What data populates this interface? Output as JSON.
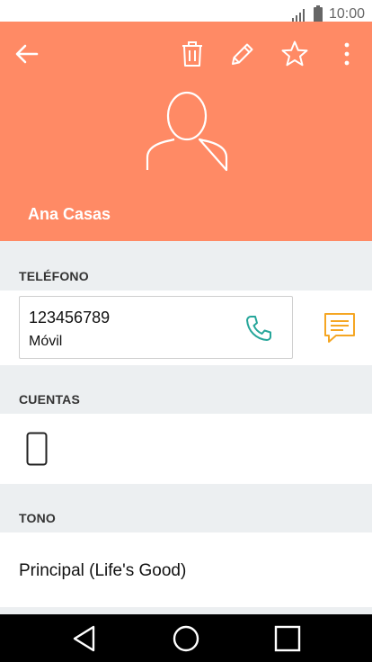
{
  "status_bar": {
    "time": "10:00",
    "signal_icon": "signal-icon",
    "battery_icon": "battery-icon"
  },
  "header": {
    "background_color": "#ff8a65",
    "back_icon": "arrow-back-icon",
    "delete_icon": "trash-icon",
    "edit_icon": "pencil-icon",
    "favorite_icon": "star-outline-icon",
    "more_icon": "more-vertical-icon",
    "avatar_icon": "person-outline-icon",
    "contact_name": "Ana Casas"
  },
  "phone_section": {
    "label": "TELÉFONO",
    "number": "123456789",
    "type": "Móvil",
    "call_icon": "phone-icon",
    "call_icon_color": "#26a69a",
    "message_icon": "message-icon",
    "message_icon_color": "#f5a623"
  },
  "accounts_section": {
    "label": "CUENTAS",
    "device_icon": "phone-device-icon"
  },
  "ringtone_section": {
    "label": "TONO",
    "value": "Principal (Life's Good)"
  },
  "nav_bar": {
    "back_icon": "triangle-back-icon",
    "home_icon": "circle-home-icon",
    "recents_icon": "square-recents-icon"
  }
}
